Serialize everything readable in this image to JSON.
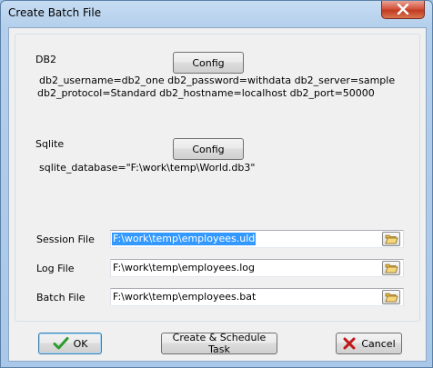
{
  "window": {
    "title": "Create Batch File"
  },
  "db2": {
    "section_label": "DB2",
    "config_button": "Config",
    "summary_line1": "db2_username=db2_one db2_password=withdata db2_server=sample",
    "summary_line2": "db2_protocol=Standard db2_hostname=localhost db2_port=50000"
  },
  "sqlite": {
    "section_label": "Sqlite",
    "config_button": "Config",
    "summary": "sqlite_database=\"F:\\work\\temp\\World.db3\""
  },
  "files": [
    {
      "label": "Session File",
      "value": "F:\\work\\temp\\employees.uld",
      "selected": true
    },
    {
      "label": "Log File",
      "value": "F:\\work\\temp\\employees.log",
      "selected": false
    },
    {
      "label": "Batch File",
      "value": "F:\\work\\temp\\employees.bat",
      "selected": false
    }
  ],
  "footer": {
    "ok": "OK",
    "schedule": "Create & Schedule Task",
    "cancel": "Cancel"
  },
  "icons": {
    "close": "close-icon",
    "folder": "folder-open-icon",
    "ok": "checkmark-icon",
    "cancel": "red-x-icon"
  },
  "colors": {
    "selection": "#3399ff",
    "ok_check": "#2e9a2e",
    "cancel_x": "#c0181a",
    "close_button": "#c9452d"
  }
}
